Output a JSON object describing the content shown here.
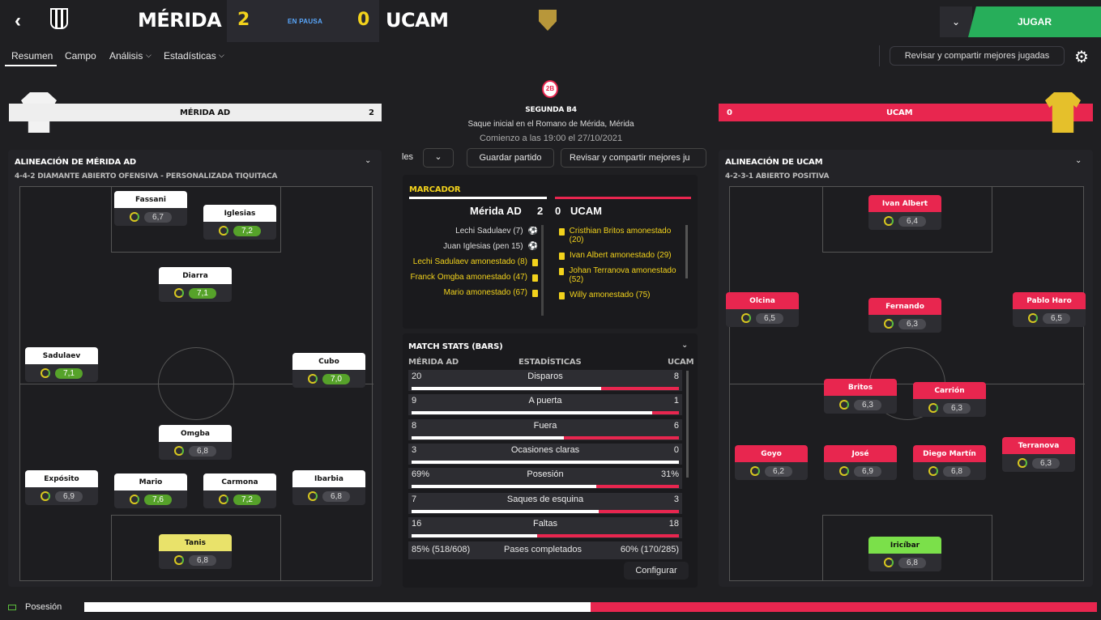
{
  "header": {
    "home_team": "MÉRIDA AD",
    "home_score": "2",
    "status": "EN PAUSA",
    "away_score": "0",
    "away_team": "UCAM",
    "play_label": "JUGAR"
  },
  "nav": {
    "tabs": [
      "Resumen",
      "Campo",
      "Análisis",
      "Estadísticas"
    ],
    "review_label": "Revisar y compartir mejores jugadas"
  },
  "home_bar": {
    "name": "MÉRIDA AD",
    "score": "2"
  },
  "away_bar": {
    "score": "0",
    "name": "UCAM"
  },
  "center": {
    "competition": "SEGUNDA B4",
    "kickoff_place": "Saque inicial en el Romano de Mérida, Mérida",
    "kickoff_time": "Comienzo a las 19:00 el 27/10/2021",
    "btn_partial": "les",
    "btn_save": "Guardar partido",
    "btn_review": "Revisar y compartir mejores ju"
  },
  "home_lineup": {
    "title": "ALINEACIÓN DE MÉRIDA AD",
    "formation": "4-4-2 DIAMANTE ABIERTO OFENSIVA - PERSONALIZADA TIQUITACA",
    "players": [
      {
        "name": "Fassani",
        "rating": "6,7"
      },
      {
        "name": "Iglesias",
        "rating": "7,2"
      },
      {
        "name": "Diarra",
        "rating": "7,1"
      },
      {
        "name": "Sadulaev",
        "rating": "7,1"
      },
      {
        "name": "Cubo",
        "rating": "7,0"
      },
      {
        "name": "Omgba",
        "rating": "6,8"
      },
      {
        "name": "Expósito",
        "rating": "6,9"
      },
      {
        "name": "Mario",
        "rating": "7,6"
      },
      {
        "name": "Carmona",
        "rating": "7,2"
      },
      {
        "name": "Ibarbia",
        "rating": "6,8"
      },
      {
        "name": "Tanis",
        "rating": "6,8"
      }
    ]
  },
  "away_lineup": {
    "title": "ALINEACIÓN DE UCAM",
    "formation": "4-2-3-1 ABIERTO POSITIVA",
    "players": [
      {
        "name": "Ivan Albert",
        "rating": "6,4"
      },
      {
        "name": "Olcina",
        "rating": "6,5"
      },
      {
        "name": "Fernando",
        "rating": "6,3"
      },
      {
        "name": "Pablo Haro",
        "rating": "6,5"
      },
      {
        "name": "Britos",
        "rating": "6,3"
      },
      {
        "name": "Carrión",
        "rating": "6,3"
      },
      {
        "name": "Goyo",
        "rating": "6,2"
      },
      {
        "name": "José",
        "rating": "6,9"
      },
      {
        "name": "Diego Martín",
        "rating": "6,8"
      },
      {
        "name": "Terranova",
        "rating": "6,3"
      },
      {
        "name": "Iricíbar",
        "rating": "6,8"
      }
    ]
  },
  "scoreboard": {
    "title": "MARCADOR",
    "home": "Mérida AD",
    "home_score": "2",
    "away_score": "0",
    "away": "UCAM",
    "home_events": [
      {
        "text": "Lechi Sadulaev (7)",
        "type": "goal"
      },
      {
        "text": "Juan Iglesias (pen 15)",
        "type": "goal"
      },
      {
        "text": "Lechi Sadulaev amonestado (8)",
        "type": "card"
      },
      {
        "text": "Franck Omgba amonestado (47)",
        "type": "card"
      },
      {
        "text": "Mario amonestado (67)",
        "type": "card"
      }
    ],
    "away_events": [
      {
        "text": "Cristhian Britos amonestado (20)"
      },
      {
        "text": "Ivan Albert amonestado (29)"
      },
      {
        "text": "Johan Terranova amonestado (52)"
      },
      {
        "text": "Willy amonestado (75)"
      }
    ]
  },
  "stats": {
    "title": "MATCH STATS (BARS)",
    "home_label": "MÉRIDA AD",
    "mid_label": "ESTADÍSTICAS",
    "away_label": "UCAM",
    "rows": [
      {
        "label": "Disparos",
        "home": "20",
        "away": "8",
        "frac": 0.71
      },
      {
        "label": "A puerta",
        "home": "9",
        "away": "1",
        "frac": 0.9
      },
      {
        "label": "Fuera",
        "home": "8",
        "away": "6",
        "frac": 0.57
      },
      {
        "label": "Ocasiones claras",
        "home": "3",
        "away": "0",
        "frac": 1.0
      },
      {
        "label": "Posesión",
        "home": "69%",
        "away": "31%",
        "frac": 0.69
      },
      {
        "label": "Saques de esquina",
        "home": "7",
        "away": "3",
        "frac": 0.7
      },
      {
        "label": "Faltas",
        "home": "16",
        "away": "18",
        "frac": 0.47
      }
    ],
    "passes": {
      "home": "85% (518/608)",
      "label": "Pases completados",
      "away": "60% (170/285)"
    },
    "configure": "Configurar"
  },
  "possession": {
    "label": "Posesión",
    "home_frac": 0.5
  }
}
